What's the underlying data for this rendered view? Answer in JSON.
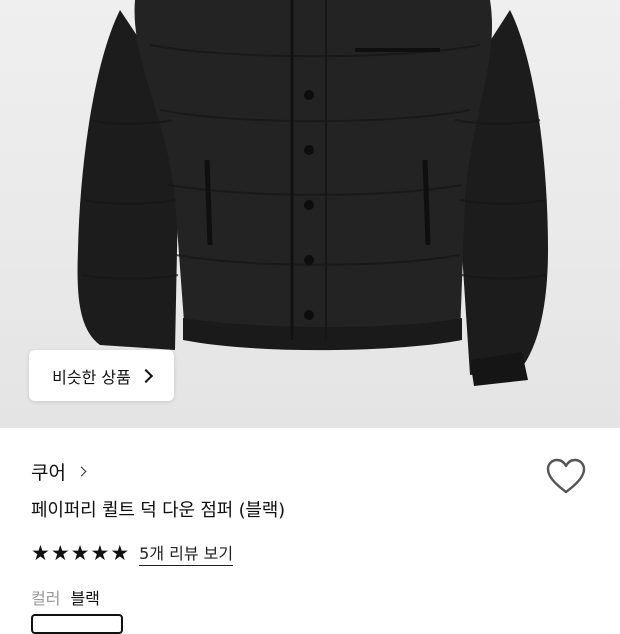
{
  "product_image": {
    "alt_icon": "black-puffer-jacket-image"
  },
  "similar_button": {
    "label": "비슷한 상품"
  },
  "brand": {
    "name": "쿠어"
  },
  "product": {
    "title": "페이퍼리 퀼트 덕 다운 점퍼 (블랙)"
  },
  "rating": {
    "stars": 5,
    "review_link": "5개 리뷰 보기"
  },
  "color": {
    "label": "컬러",
    "value": "블랙"
  },
  "colors": {
    "star": "#111111",
    "heart_stroke": "#555555",
    "background_photo": "#ebebeb"
  }
}
